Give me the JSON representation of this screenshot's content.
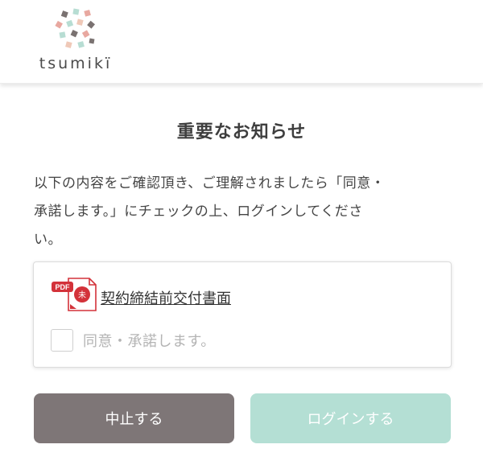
{
  "header": {
    "logo_text": "tsumikï",
    "logo_colors": [
      "#7a7271",
      "#e8a8a0",
      "#b7ddd3",
      "#efc9b8"
    ]
  },
  "main": {
    "title": "重要なお知らせ",
    "notice_lines": [
      "以下の内容をご確認頂き、ご理解されましたら「同意・",
      "承諾します。」にチェックの上、ログインしてくださ",
      "い。"
    ]
  },
  "document": {
    "icon": "pdf-document-icon",
    "pdf_badge": "PDF",
    "seal_char": "未",
    "link_text": "契約締結前交付書面",
    "agree_label": "同意・承諾します。",
    "agree_checked": false
  },
  "buttons": {
    "cancel_label": "中止する",
    "login_label": "ログインする",
    "cancel_color": "#7e7677",
    "login_color": "#b4dfd4"
  }
}
